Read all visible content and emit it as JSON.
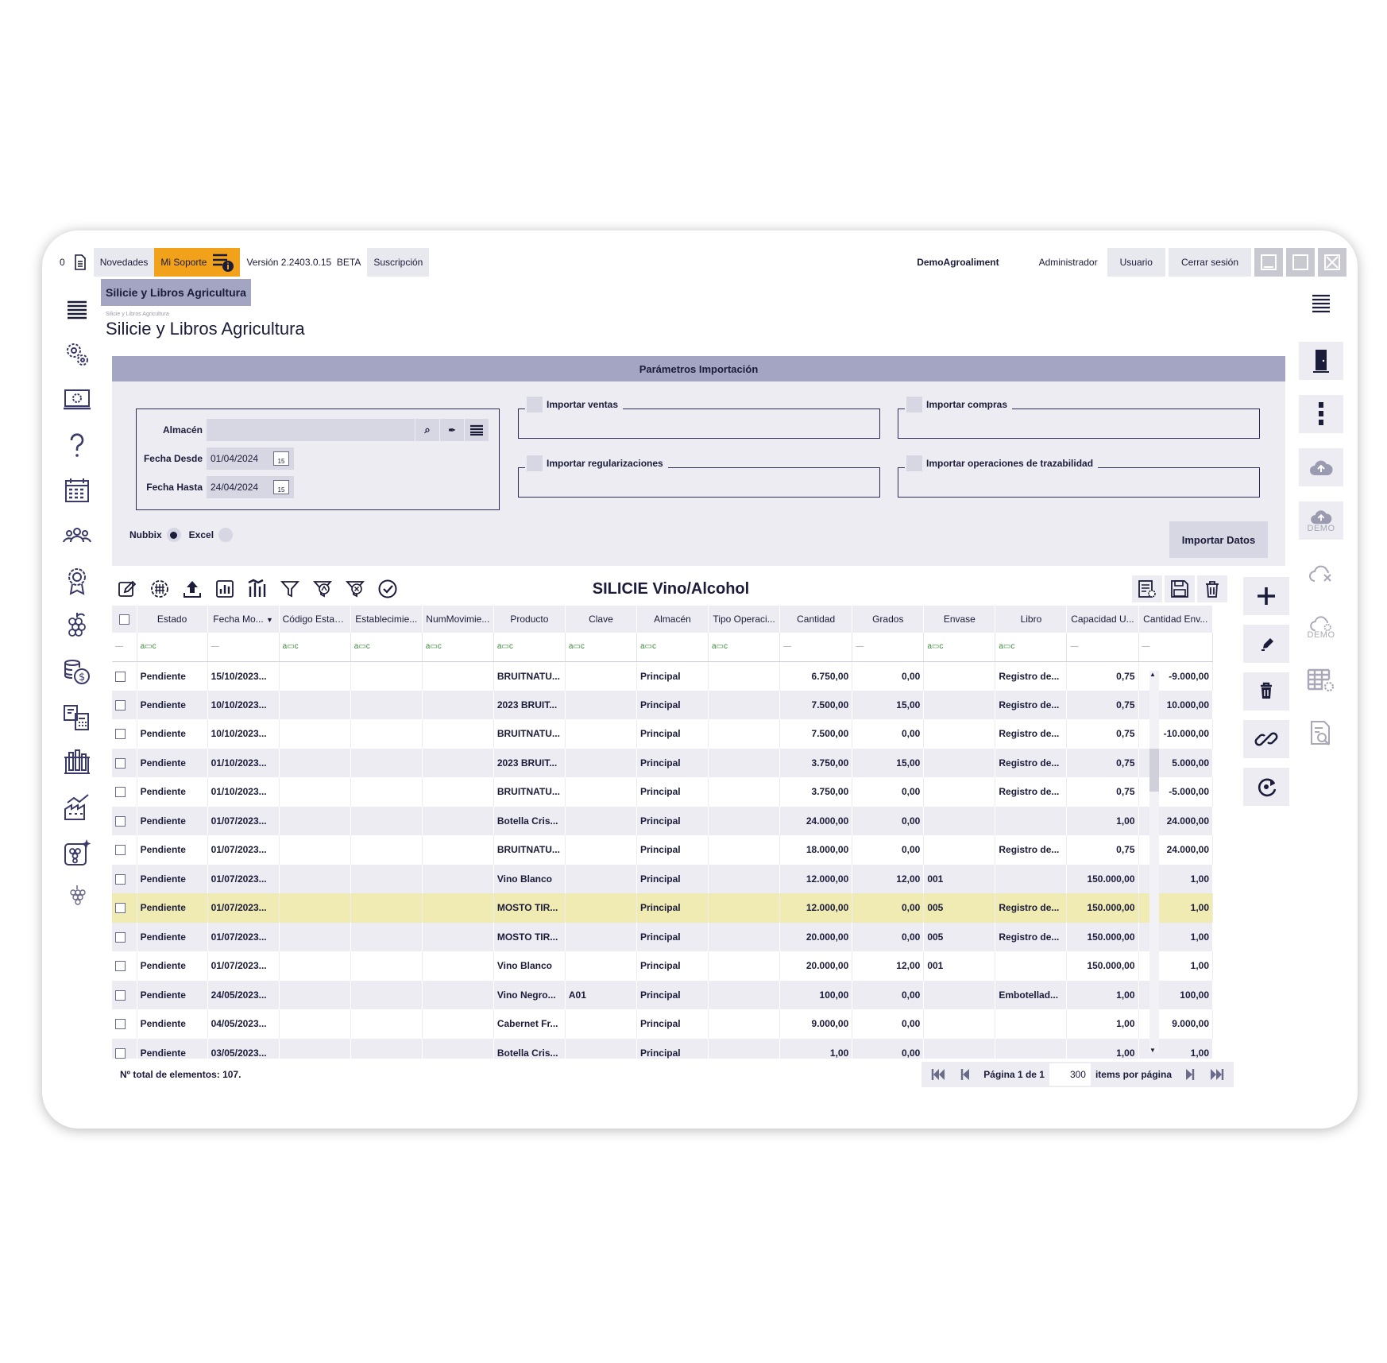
{
  "topbar": {
    "counter": "0",
    "novedades": "Novedades",
    "soporte": "Mi Soporte",
    "version": "Versión 2.2403.0.15",
    "beta": "BETA",
    "suscripcion": "Suscripción",
    "company": "DemoAgroaliment",
    "role": "Administrador",
    "usuario": "Usuario",
    "logout": "Cerrar sesión"
  },
  "breadcrumb": "Silicie y Libros Agricultura",
  "tiny_crumb": "Silicie y Libros Agricultura",
  "page_title": "Silicie y Libros Agricultura",
  "params": {
    "header": "Parámetros Importación",
    "almacen_label": "Almacén",
    "almacen_value": "",
    "fecha_desde_label": "Fecha Desde",
    "fecha_desde_value": "01/04/2024",
    "fecha_hasta_label": "Fecha Hasta",
    "fecha_hasta_value": "24/04/2024",
    "calendar_day": "15",
    "importar_ventas": "Importar ventas",
    "importar_compras": "Importar compras",
    "importar_regularizaciones": "Importar regularizaciones",
    "importar_trazabilidad": "Importar operaciones de trazabilidad",
    "radio_nubbix": "Nubbix",
    "radio_excel": "Excel",
    "selected_source": "Nubbix",
    "import_button": "Importar Datos"
  },
  "right_sidebar": {
    "demo_label": "DEMO"
  },
  "grid": {
    "title": "SILICIE Vino/Alcohol",
    "columns": [
      "Estado",
      "Fecha Mo...",
      "Código Estab...",
      "Establecimie...",
      "NumMovimie...",
      "Producto",
      "Clave",
      "Almacén",
      "Tipo Operaci...",
      "Cantidad",
      "Grados",
      "Envase",
      "Libro",
      "Capacidad U...",
      "Cantidad Env..."
    ],
    "rows": [
      [
        "Pendiente",
        "15/10/2023...",
        "",
        "",
        "",
        "BRUITNATU...",
        "",
        "Principal",
        "",
        "6.750,00",
        "0,00",
        "",
        "Registro de...",
        "0,75",
        "-9.000,00"
      ],
      [
        "Pendiente",
        "10/10/2023...",
        "",
        "",
        "",
        "2023 BRUIT...",
        "",
        "Principal",
        "",
        "7.500,00",
        "15,00",
        "",
        "Registro de...",
        "0,75",
        "10.000,00"
      ],
      [
        "Pendiente",
        "10/10/2023...",
        "",
        "",
        "",
        "BRUITNATU...",
        "",
        "Principal",
        "",
        "7.500,00",
        "0,00",
        "",
        "Registro de...",
        "0,75",
        "-10.000,00"
      ],
      [
        "Pendiente",
        "01/10/2023...",
        "",
        "",
        "",
        "2023 BRUIT...",
        "",
        "Principal",
        "",
        "3.750,00",
        "15,00",
        "",
        "Registro de...",
        "0,75",
        "5.000,00"
      ],
      [
        "Pendiente",
        "01/10/2023...",
        "",
        "",
        "",
        "BRUITNATU...",
        "",
        "Principal",
        "",
        "3.750,00",
        "0,00",
        "",
        "Registro de...",
        "0,75",
        "-5.000,00"
      ],
      [
        "Pendiente",
        "01/07/2023...",
        "",
        "",
        "",
        "Botella Cris...",
        "",
        "Principal",
        "",
        "24.000,00",
        "0,00",
        "",
        "",
        "1,00",
        "24.000,00"
      ],
      [
        "Pendiente",
        "01/07/2023...",
        "",
        "",
        "",
        "BRUITNATU...",
        "",
        "Principal",
        "",
        "18.000,00",
        "0,00",
        "",
        "Registro de...",
        "0,75",
        "24.000,00"
      ],
      [
        "Pendiente",
        "01/07/2023...",
        "",
        "",
        "",
        "Vino Blanco",
        "",
        "Principal",
        "",
        "12.000,00",
        "12,00",
        "001",
        "",
        "150.000,00",
        "1,00"
      ],
      [
        "Pendiente",
        "01/07/2023...",
        "",
        "",
        "",
        "MOSTO TIR...",
        "",
        "Principal",
        "",
        "12.000,00",
        "0,00",
        "005",
        "Registro de...",
        "150.000,00",
        "1,00"
      ],
      [
        "Pendiente",
        "01/07/2023...",
        "",
        "",
        "",
        "MOSTO TIR...",
        "",
        "Principal",
        "",
        "20.000,00",
        "0,00",
        "005",
        "Registro de...",
        "150.000,00",
        "1,00"
      ],
      [
        "Pendiente",
        "01/07/2023...",
        "",
        "",
        "",
        "Vino Blanco",
        "",
        "Principal",
        "",
        "20.000,00",
        "12,00",
        "001",
        "",
        "150.000,00",
        "1,00"
      ],
      [
        "Pendiente",
        "24/05/2023...",
        "",
        "",
        "",
        "Vino Negro...",
        "A01",
        "Principal",
        "",
        "100,00",
        "0,00",
        "",
        "Embotellad...",
        "1,00",
        "100,00"
      ],
      [
        "Pendiente",
        "04/05/2023...",
        "",
        "",
        "",
        "Cabernet Fr...",
        "",
        "Principal",
        "",
        "9.000,00",
        "0,00",
        "",
        "",
        "1,00",
        "9.000,00"
      ],
      [
        "Pendiente",
        "03/05/2023...",
        "",
        "",
        "",
        "Botella Cris...",
        "",
        "Principal",
        "",
        "1,00",
        "0,00",
        "",
        "",
        "1,00",
        "1,00"
      ]
    ],
    "highlight_row": 8,
    "total_label": "Nº total de elementos: 107.",
    "page_label": "Página 1 de 1",
    "per_page_value": "300",
    "per_page_label": "items por página"
  },
  "colors": {
    "accent": "#a4a4c3",
    "panel": "#ececf2",
    "orange": "#f2a11a",
    "highlight": "#efebb3",
    "ink": "#1b1b3a"
  }
}
